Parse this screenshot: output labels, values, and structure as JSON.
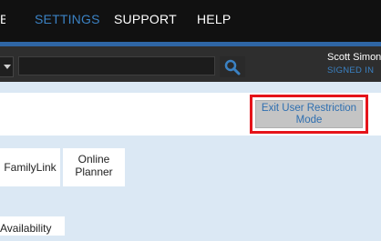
{
  "nav": {
    "prev_fragment": "B",
    "settings": "SETTINGS",
    "support": "SUPPORT",
    "help": "HELP"
  },
  "search": {
    "value": "",
    "placeholder": ""
  },
  "user": {
    "name": "Scott Simon",
    "status": "SIGNED IN"
  },
  "exit_button": {
    "line1": "Exit User Restriction",
    "line2": "Mode"
  },
  "tabs": {
    "familylink": "FamilyLink",
    "online_line1": "Online",
    "online_line2": "Planner",
    "availability": "Availability"
  },
  "colors": {
    "accent": "#3b82c4",
    "highlight_border": "#e5141a"
  },
  "icons": {
    "search": "magnifier-icon",
    "dropdown": "caret-down-icon"
  }
}
